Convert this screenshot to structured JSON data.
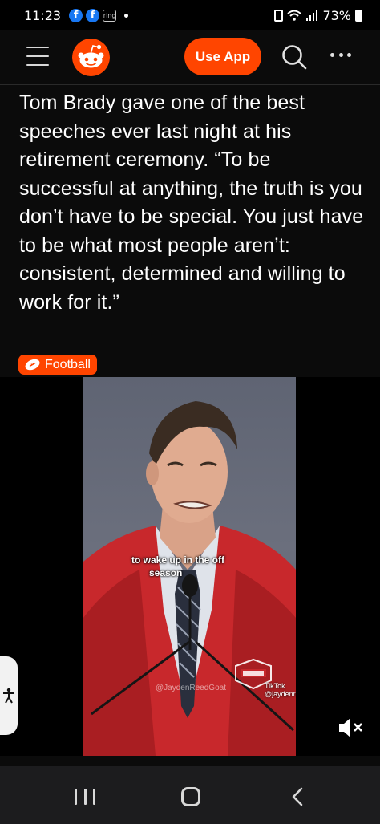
{
  "status_bar": {
    "time": "11:23",
    "notification_badge": "ring",
    "battery": "73%"
  },
  "header": {
    "use_app_label": "Use App",
    "logo_icon": "reddit-snoo-icon",
    "brand_color": "#ff4500"
  },
  "post": {
    "title": "Tom Brady gave one of the best speeches ever last night at his retirement ceremony. “To be successful at anything, the truth is you don’t have to be special. You just have to be what most people aren’t: consistent, determined and willing to work for it.”",
    "flair": "Football",
    "flair_color": "#ff4500"
  },
  "video": {
    "caption_line1": "to wake up in the off",
    "caption_line2": "season",
    "watermark": "@JaydenReedGoat",
    "tiktok_label": "TikTok",
    "tiktok_handle": "@jaydenreedgoat",
    "muted": true
  }
}
